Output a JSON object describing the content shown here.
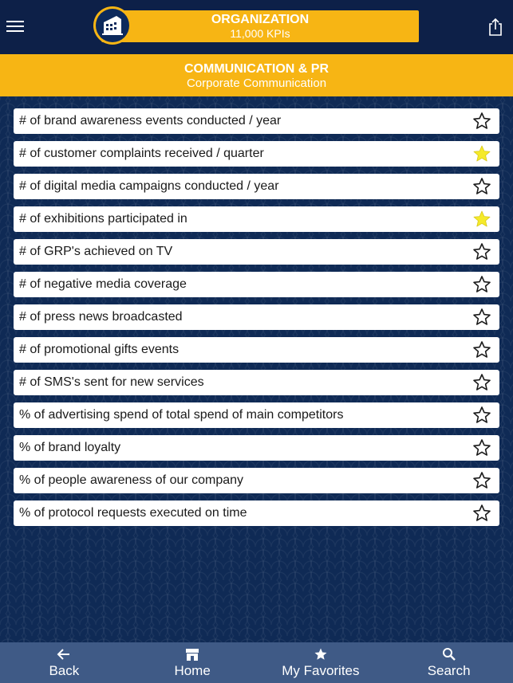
{
  "header": {
    "org_title": "ORGANIZATION",
    "org_subtitle": "11,000 KPIs",
    "icons": {
      "menu": "menu-icon",
      "logo": "building-icon",
      "share": "share-icon"
    }
  },
  "category": {
    "title": "COMMUNICATION & PR",
    "subtitle": "Corporate Communication"
  },
  "kpis": [
    {
      "label": "# of brand awareness events conducted / year",
      "favorite": false
    },
    {
      "label": "# of customer complaints received / quarter",
      "favorite": true
    },
    {
      "label": "# of digital media campaigns conducted / year",
      "favorite": false
    },
    {
      "label": "# of exhibitions participated in",
      "favorite": true
    },
    {
      "label": "# of GRP's achieved on TV",
      "favorite": false
    },
    {
      "label": "# of negative media coverage",
      "favorite": false
    },
    {
      "label": "# of press news broadcasted",
      "favorite": false
    },
    {
      "label": "# of promotional gifts events",
      "favorite": false
    },
    {
      "label": "# of SMS's sent for new services",
      "favorite": false
    },
    {
      "label": "% of advertising spend of total spend of main competitors",
      "favorite": false
    },
    {
      "label": "% of brand loyalty",
      "favorite": false
    },
    {
      "label": "% of people awareness of our company",
      "favorite": false
    },
    {
      "label": "% of protocol requests executed on time",
      "favorite": false
    }
  ],
  "colors": {
    "star_favorite": "#f5ea2a",
    "star_outline": "#1a1a1a",
    "accent": "#f7b514",
    "nav_bg": "#3f5a86"
  },
  "nav": {
    "back": "Back",
    "home": "Home",
    "favorites": "My Favorites",
    "search": "Search"
  }
}
